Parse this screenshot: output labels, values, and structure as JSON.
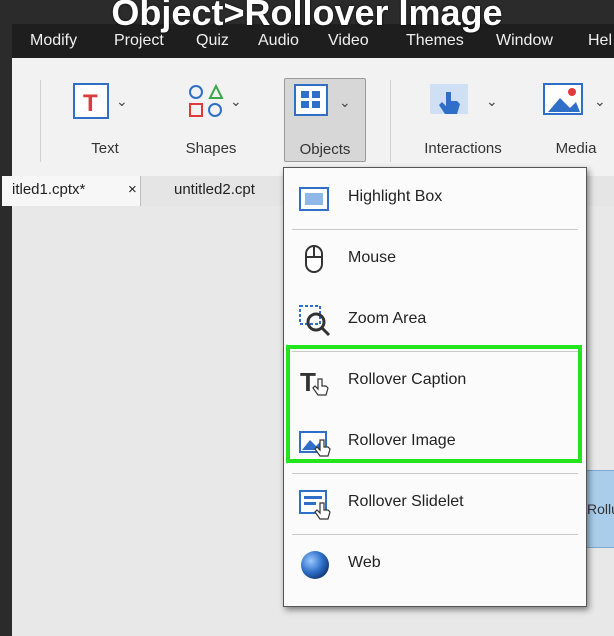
{
  "caption": "Object>Rollover Image",
  "menubar": [
    "Modify",
    "Project",
    "Quiz",
    "Audio",
    "Video",
    "Themes",
    "Window",
    "Hel"
  ],
  "toolbar": {
    "text": "Text",
    "shapes": "Shapes",
    "objects": "Objects",
    "interactions": "Interactions",
    "media": "Media"
  },
  "tabs": [
    "itled1.cptx*",
    "×",
    "untitled2.cpt"
  ],
  "dropdown": {
    "items": [
      {
        "label": "Highlight Box",
        "icon": "highlight-box-icon"
      },
      {
        "label": "Mouse",
        "icon": "mouse-icon"
      },
      {
        "label": "Zoom Area",
        "icon": "zoom-area-icon"
      },
      {
        "label": "Rollover Caption",
        "icon": "rollover-caption-icon"
      },
      {
        "label": "Rollover Image",
        "icon": "rollover-image-icon"
      },
      {
        "label": "Rollover Slidelet",
        "icon": "rollover-slidelet-icon"
      },
      {
        "label": "Web",
        "icon": "web-icon"
      }
    ]
  },
  "stage_object_label": "Rollu",
  "colors": {
    "highlight": "#22e51e",
    "menubar": "#1e1e1e",
    "accent": "#2f6fc8"
  }
}
